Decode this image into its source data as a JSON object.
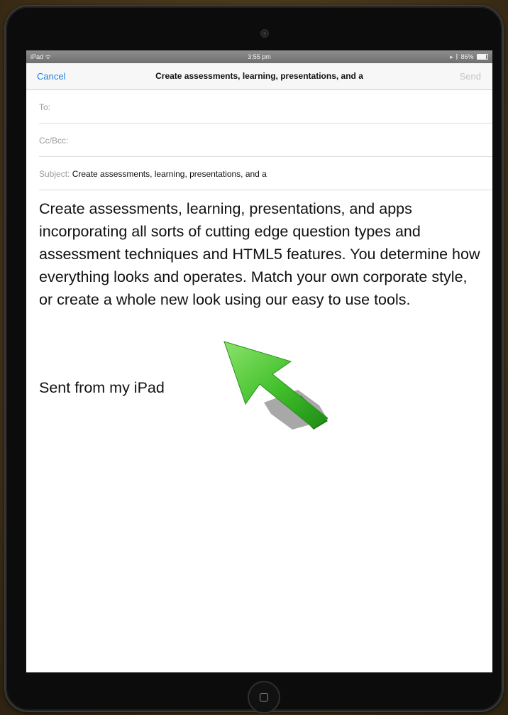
{
  "status_bar": {
    "device": "iPad",
    "time": "3:55 pm",
    "battery": "86%",
    "battery_level": 0.86
  },
  "nav": {
    "cancel_label": "Cancel",
    "title": "Create assessments, learning, presentations, and a",
    "send_label": "Send"
  },
  "fields": {
    "to_label": "To:",
    "to_value": "",
    "cc_label": "Cc/Bcc:",
    "cc_value": "",
    "subject_label": "Subject:",
    "subject_value": "Create assessments, learning, presentations, and a"
  },
  "body": {
    "text": "Create assessments, learning, presentations, and apps incorporating all sorts of cutting edge question types and assessment techniques and HTML5 features. You determine how everything looks and operates. Match your own corporate style, or create a whole new look using our easy to use tools.",
    "signature": "Sent from my iPad"
  },
  "colors": {
    "accent": "#1f7fe0",
    "arrow": "#3fbf2a",
    "frame": "#0c0c0c"
  },
  "icons": {
    "arrow": "green-pointer-arrow",
    "home": "home-button-icon",
    "camera": "camera-icon"
  }
}
